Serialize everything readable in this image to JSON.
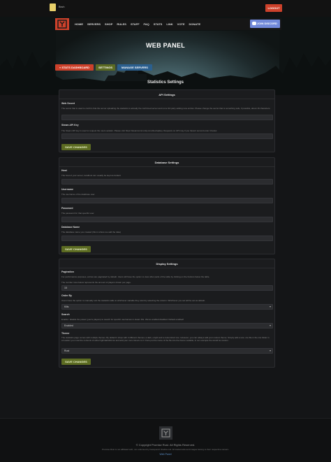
{
  "topbar": {
    "username": "Bruh",
    "logout": "LOGOUT"
  },
  "nav": {
    "items": [
      "HOME",
      "SERVERS",
      "SHOP",
      "RULES",
      "STAFF",
      "FAQ",
      "STATS",
      "LINK",
      "VOTE",
      "DONATE"
    ],
    "discord": "JOIN DISCORD"
  },
  "page": {
    "title": "WEB PANEL"
  },
  "tabs": {
    "stats": "« STATS DASHBOARD",
    "settings": "SETTINGS",
    "manage": "MANAGE SERVERS"
  },
  "main": {
    "title": "Statistics Settings"
  },
  "api": {
    "title": "API Settings",
    "web_secret": {
      "label": "Web Secret",
      "desc": "The secret that is used to confirm that the server uploading the statistics is actually the confirmed server and not a 3rd party adding new entries. Please change the secret that is something safe, if possible, about 16 characters."
    },
    "steam_key": {
      "label": "Steam API Key",
      "desc": "The Steam API key is used to request the users avatars. Please visit https://steamcommunity.com/dev/apikey. Requests on API may if you havent set and enter it below."
    },
    "save": "SAVE CHANGES"
  },
  "database": {
    "title": "Database Settings",
    "host": {
      "label": "Host",
      "desc": "The host of your server, localhost can usually be kept as default."
    },
    "username": {
      "label": "Username",
      "desc": "The username of the database user."
    },
    "password": {
      "label": "Password",
      "desc": "The password for that specific user."
    },
    "dbname": {
      "label": "Database Name",
      "desc": "The database name you created (this is where we add the data)"
    },
    "save": "SAVE CHANGES"
  },
  "display": {
    "title": "Display Settings",
    "pagination": {
      "label": "Pagination",
      "desc1": "For performance purposes, entries are paginated by default. Users will have the option to view other parts of the table by clicking on the buttons below the table.",
      "desc2": "The number rows below represents the amount of players shown per page.",
      "value": "15"
    },
    "order": {
      "label": "Order By",
      "desc": "Users have the option to manually sort the statistics table to whichever variable they want by selecting the column. Whichever you set will be set as default.",
      "value": "Kills"
    },
    "search": {
      "label": "Search",
      "desc": "Enable / disable the power (you're players) to search for specific usernames in steam IDs. We've enabled disabled. Default enabled!",
      "value": "Enabled"
    },
    "theme": {
      "label": "Theme",
      "desc": "The statistics page comes with multiple themes. By default it ships with 4 different themes; a dark, a light and a customized one. However, you can always add your custom theme. Simply add a new .css file in the css folder in a location you must the contents of either light/dark/all.css and add your own colours to it. Once put the name of the file into the theme variable, in our example the would be custom.",
      "value": "Rust"
    },
    "save": "SAVE CHANGES"
  },
  "footer": {
    "copyright": "© Copyright Promise Rust. All Rights Reserved.",
    "disclaimer": "Promise Rust is not affiliated with, nor endorsed by Facepunch Studios Ltd. All trademarks and images belong to their respective owners.",
    "link": "Web Panel"
  }
}
